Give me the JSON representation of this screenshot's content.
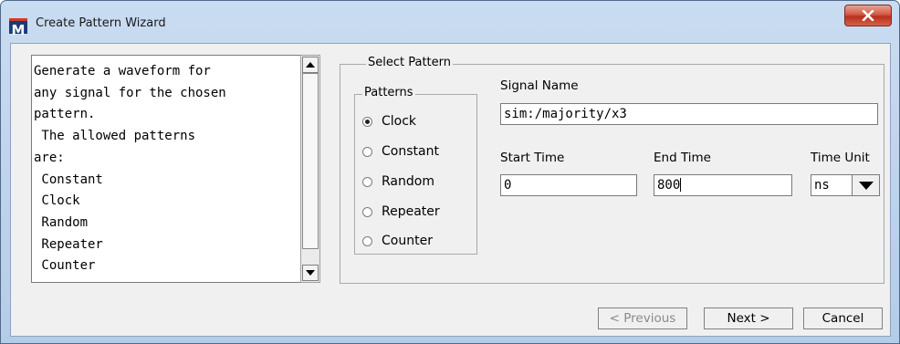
{
  "window": {
    "title": "Create Pattern Wizard",
    "app_icon_letter": "M",
    "close_label": "x"
  },
  "description": {
    "text": "Generate a waveform for\nany signal for the chosen\npattern.\n The allowed patterns\nare:\n Constant\n Clock\n Random\n Repeater\n Counter"
  },
  "select_pattern": {
    "group_title": "Select Pattern",
    "patterns_title": "Patterns",
    "options": [
      {
        "label": "Clock",
        "selected": true
      },
      {
        "label": "Constant",
        "selected": false
      },
      {
        "label": "Random",
        "selected": false
      },
      {
        "label": "Repeater",
        "selected": false
      },
      {
        "label": "Counter",
        "selected": false
      }
    ],
    "signal_name_label": "Signal Name",
    "signal_name_value": "sim:/majority/x3",
    "start_time_label": "Start Time",
    "start_time_value": "0",
    "end_time_label": "End Time",
    "end_time_value": "800",
    "time_unit_label": "Time Unit",
    "time_unit_value": "ns"
  },
  "buttons": {
    "previous": "< Previous",
    "next": "Next >",
    "cancel": "Cancel"
  }
}
